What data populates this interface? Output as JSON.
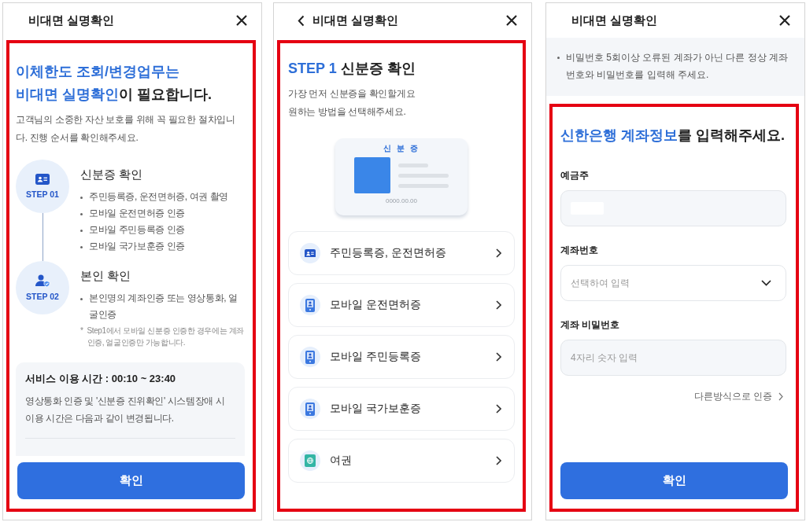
{
  "screens": [
    {
      "kind": "intro",
      "header": {
        "title": "비대면 실명확인",
        "back": false
      },
      "heading": [
        [
          {
            "text": "이체한도 조회/변경업무는",
            "highlight": true
          }
        ],
        [
          {
            "text": "비대면 실명확인",
            "highlight": true
          },
          {
            "text": "이 필요합니다.",
            "highlight": false
          }
        ]
      ],
      "description": "고객님의 소중한 자산 보호를 위해 꼭 필요한 절차입니다. 진행 순서를 확인해주세요.",
      "steps": [
        {
          "label": "STEP 01",
          "kind": "id-card",
          "title": "신분증 확인",
          "bullets": [
            "주민등록증, 운전면허증, 여권 촬영",
            "모바일 운전면허증 인증",
            "모바일 주민등록증 인증",
            "모바일 국가보훈증 인증"
          ]
        },
        {
          "label": "STEP 02",
          "kind": "person-check",
          "title": "본인 확인",
          "bullets": [
            "본인명의 계좌인증 또는 영상통화, 얼굴인증"
          ],
          "note": {
            "mark": "*",
            "text": "Step1에서 모바일 신분증 인증한 경우에는 계좌인증, 얼굴인증만 가능합니다."
          }
        }
      ],
      "service_card": {
        "title": "서비스 이용 시간 : 00:10 ~ 23:40",
        "text": "영상통화 인증 및 '신분증 진위확인' 시스템장애 시 이용 시간은 다음과 같이 변경됩니다."
      },
      "button": "확인"
    },
    {
      "kind": "id_select",
      "header": {
        "title": "비대면 실명확인",
        "back": true
      },
      "heading": [
        [
          {
            "text": "STEP 1",
            "highlight": true
          },
          {
            "text": " 신분증 확인",
            "highlight": false
          }
        ]
      ],
      "description_lines": [
        "가장 먼저 신분증을 확인할게요",
        "원하는 방법을 선택해주세요."
      ],
      "id_card": {
        "title": "신 분 증",
        "date": "0000.00.00"
      },
      "options": [
        {
          "kind": "id-card",
          "label": "주민등록증, 운전면허증"
        },
        {
          "kind": "mobile",
          "label": "모바일 운전면허증"
        },
        {
          "kind": "mobile",
          "label": "모바일 주민등록증"
        },
        {
          "kind": "mobile",
          "label": "모바일 국가보훈증"
        },
        {
          "kind": "passport",
          "label": "여권"
        }
      ]
    },
    {
      "kind": "account_form",
      "header": {
        "title": "비대면 실명확인",
        "back": false
      },
      "notice": "비밀번호 5회이상 오류된 계좌가 아닌 다른 정상 계좌번호와 비밀번호를 입력해 주세요.",
      "heading": [
        [
          {
            "text": "신한은행 계좌정보",
            "highlight": true
          },
          {
            "text": "를 입력해주세요.",
            "highlight": false
          }
        ]
      ],
      "fields": [
        {
          "kind": "redacted",
          "label": "예금주"
        },
        {
          "kind": "select",
          "label": "계좌번호",
          "placeholder": "선택하여 입력"
        },
        {
          "kind": "input",
          "label": "계좌 비밀번호",
          "placeholder": "4자리 숫자 입력"
        }
      ],
      "link": "다른방식으로 인증",
      "button": "확인"
    }
  ]
}
